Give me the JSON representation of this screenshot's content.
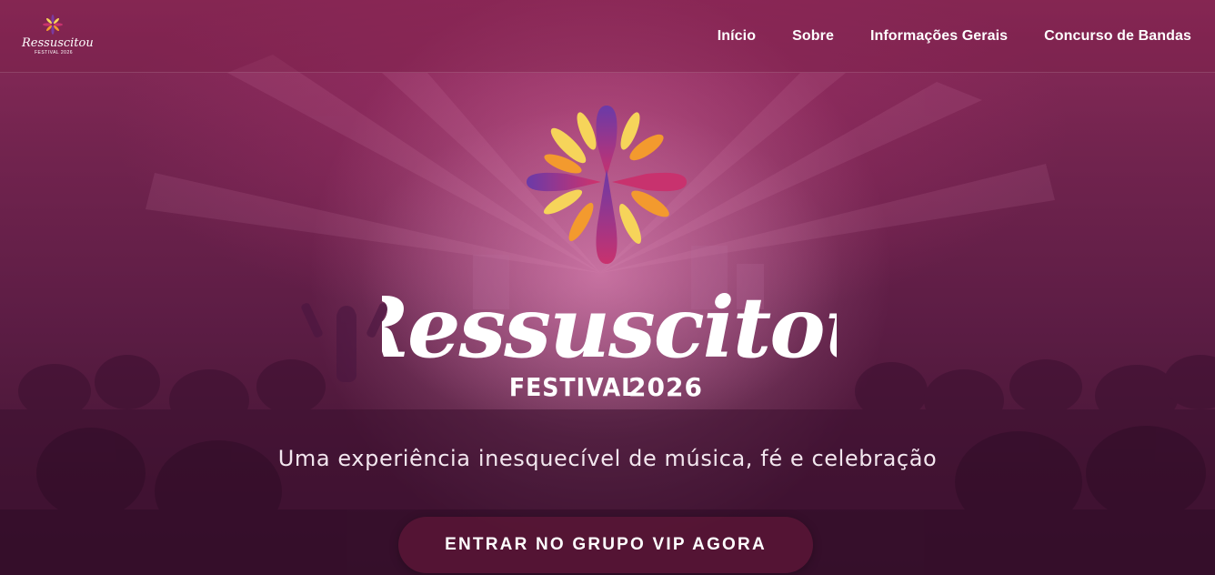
{
  "brand": {
    "logo_text": "Ressuscitou",
    "logo_subtext": "FESTIVAL 2026"
  },
  "nav": {
    "items": [
      {
        "label": "Início"
      },
      {
        "label": "Sobre"
      },
      {
        "label": "Informações Gerais"
      },
      {
        "label": "Concurso de Bandas"
      }
    ]
  },
  "hero": {
    "logo_script": "Ressuscitou",
    "logo_festival": "FESTIVAL",
    "logo_year": "2026",
    "tagline": "Uma experiência inesquecível de música, fé e celebração",
    "cta_label": "ENTRAR NO GRUPO VIP AGORA"
  },
  "colors": {
    "overlay": "#7a2452",
    "flower_yellow": "#f6d45a",
    "flower_orange": "#f39a2e",
    "flower_purple": "#7a3aa0",
    "flower_magenta": "#c8326e"
  }
}
